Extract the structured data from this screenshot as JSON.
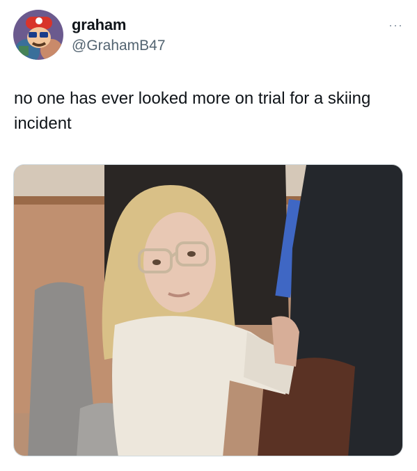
{
  "tweet": {
    "author_name": "graham",
    "author_handle": "@GrahamB47",
    "more_label": "···",
    "text": "no one has ever looked more on trial for a skiing incident",
    "avatar_icon": "avatar-illustration",
    "media_icon": "photo"
  }
}
